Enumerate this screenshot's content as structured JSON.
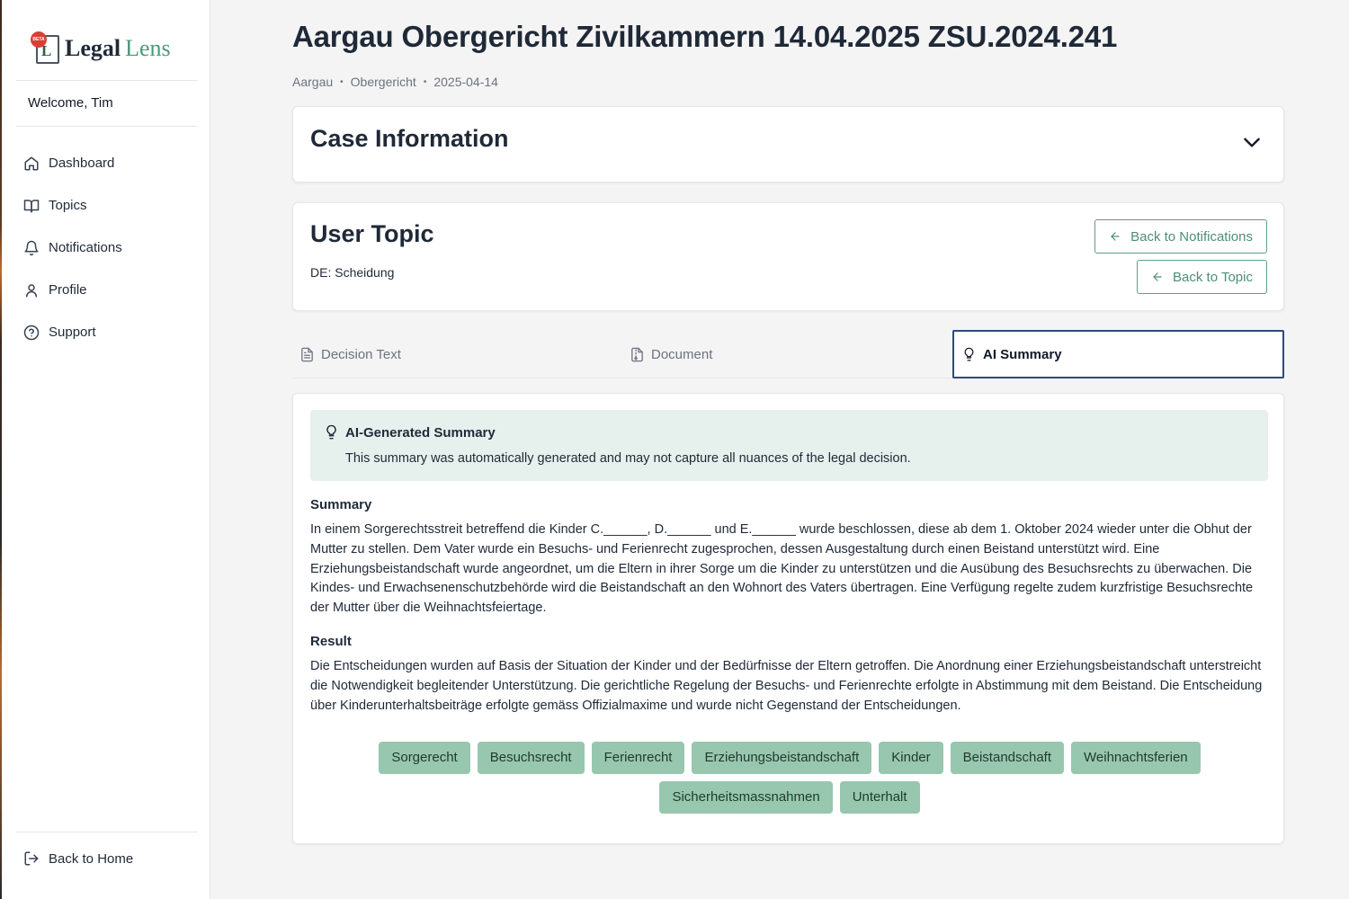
{
  "app": {
    "logo_word1": "Legal",
    "logo_word2": "Lens",
    "logo_mark": "L",
    "beta_badge": "BETA"
  },
  "sidebar": {
    "welcome": "Welcome, Tim",
    "items": [
      {
        "label": "Dashboard",
        "icon": "home-icon"
      },
      {
        "label": "Topics",
        "icon": "book-open-icon"
      },
      {
        "label": "Notifications",
        "icon": "bell-icon"
      },
      {
        "label": "Profile",
        "icon": "user-icon"
      },
      {
        "label": "Support",
        "icon": "help-circle-icon"
      }
    ],
    "back_home": "Back to Home"
  },
  "page": {
    "title": "Aargau Obergericht Zivilkammern 14.04.2025 ZSU.2024.241",
    "breadcrumb": [
      "Aargau",
      "Obergericht",
      "2025-04-14"
    ]
  },
  "case_info": {
    "title": "Case Information"
  },
  "user_topic": {
    "title": "User Topic",
    "subtitle": "DE: Scheidung",
    "back_to_notifications": "Back to Notifications",
    "back_to_topic": "Back to Topic"
  },
  "tabs": {
    "decision_text": "Decision Text",
    "document": "Document",
    "ai_summary": "AI Summary",
    "active": "AI Summary"
  },
  "ai_summary": {
    "notice_title": "AI-Generated Summary",
    "notice_text": "This summary was automatically generated and may not capture all nuances of the legal decision.",
    "summary_heading": "Summary",
    "summary_text": "In einem Sorgerechtsstreit betreffend die Kinder C.______, D.______ und E.______ wurde beschlossen, diese ab dem 1. Oktober 2024 wieder unter die Obhut der Mutter zu stellen. Dem Vater wurde ein Besuchs- und Ferienrecht zugesprochen, dessen Ausgestaltung durch einen Beistand unterstützt wird. Eine Erziehungsbeistandschaft wurde angeordnet, um die Eltern in ihrer Sorge um die Kinder zu unterstützen und die Ausübung des Besuchsrechts zu überwachen. Die Kindes- und Erwachsenenschutzbehörde wird die Beistandschaft an den Wohnort des Vaters übertragen. Eine Verfügung regelte zudem kurzfristige Besuchsrechte der Mutter über die Weihnachtsfeiertage.",
    "result_heading": "Result",
    "result_text": "Die Entscheidungen wurden auf Basis der Situation der Kinder und der Bedürfnisse der Eltern getroffen. Die Anordnung einer Erziehungsbeistandschaft unterstreicht die Notwendigkeit begleitender Unterstützung. Die gerichtliche Regelung der Besuchs- und Ferienrechte erfolgte in Abstimmung mit dem Beistand. Die Entscheidung über Kinderunterhaltsbeiträge erfolgte gemäss Offizialmaxime und wurde nicht Gegenstand der Entscheidungen.",
    "tags": [
      "Sorgerecht",
      "Besuchsrecht",
      "Ferienrecht",
      "Erziehungsbeistandschaft",
      "Kinder",
      "Beistandschaft",
      "Weihnachtsferien",
      "Sicherheitsmassnahmen",
      "Unterhalt"
    ]
  },
  "colors": {
    "accent_green": "#4c8f74",
    "tag_bg": "#97c7af",
    "notice_bg": "#e6f0ec",
    "active_tab_border": "#2c4a7c"
  }
}
